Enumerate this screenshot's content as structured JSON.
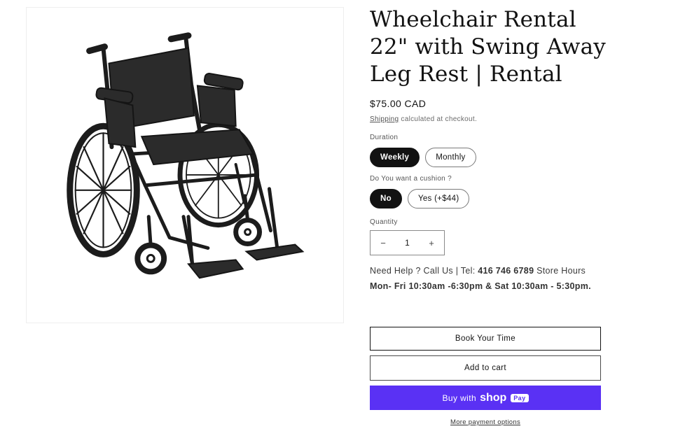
{
  "product": {
    "image_alt": "wheelchair-photo",
    "title": "Wheelchair Rental 22\" with Swing Away Leg Rest | Rental",
    "price": "$75.00 CAD",
    "shipping_link": "Shipping",
    "shipping_note": " calculated at checkout."
  },
  "options": {
    "duration": {
      "label": "Duration",
      "choices": [
        "Weekly",
        "Monthly"
      ],
      "selected": "Weekly"
    },
    "cushion": {
      "label": "Do You want a cushion ?",
      "choices": [
        "No",
        "Yes (+$44)"
      ],
      "selected": "No"
    }
  },
  "quantity": {
    "label": "Quantity",
    "value": "1",
    "minus": "−",
    "plus": "+"
  },
  "help": {
    "prefix": "Need Help ? Call Us | Tel: ",
    "phone": "416 746 6789",
    "middle": " Store Hours ",
    "hours": "Mon- Fri 10:30am -6:30pm & Sat 10:30am - 5:30pm."
  },
  "actions": {
    "book": "Book Your Time",
    "add_to_cart": "Add to cart",
    "buy_with": "Buy with",
    "shop_word": "shop",
    "pay_badge": "Pay",
    "more_payment": "More payment options"
  },
  "colors": {
    "shop_pay": "#5a31f4",
    "selected_pill": "#121212"
  }
}
